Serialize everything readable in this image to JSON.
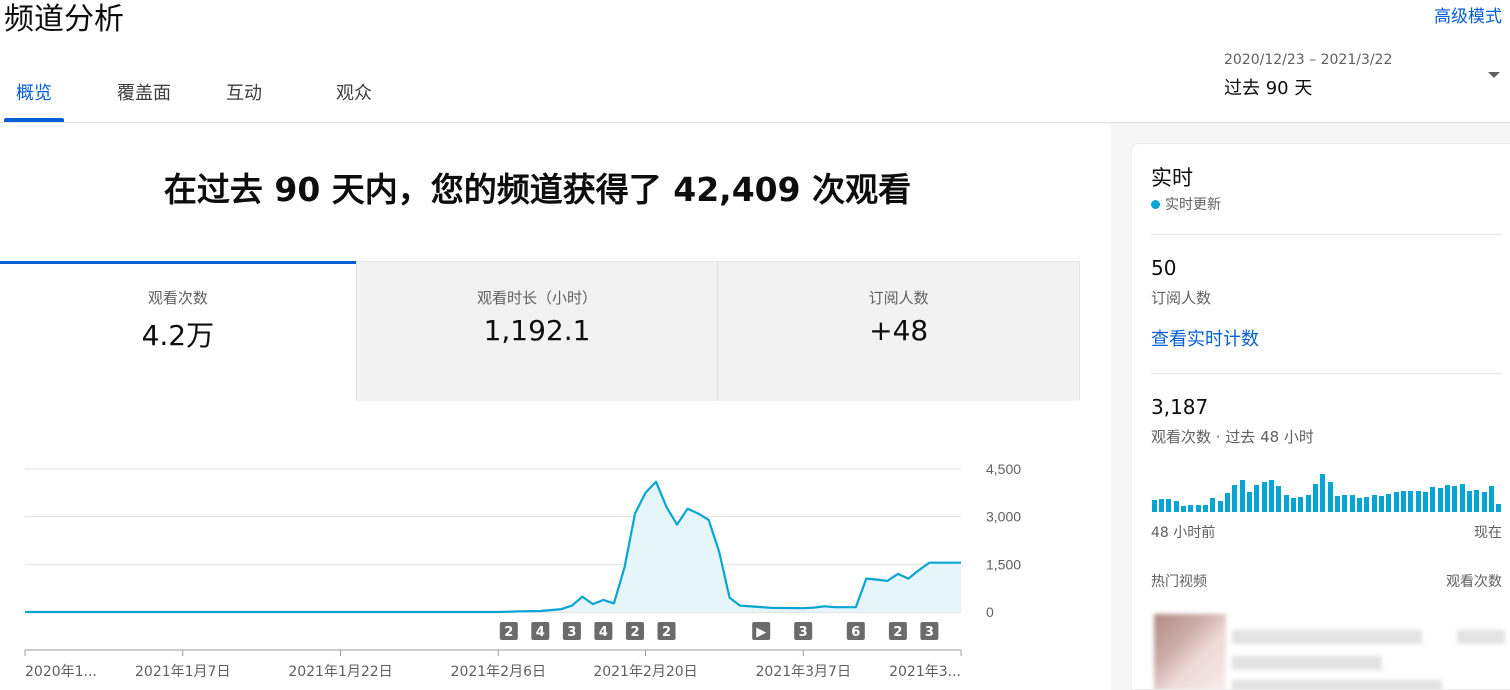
{
  "header": {
    "title": "频道分析",
    "advanced_mode": "高级模式"
  },
  "tabs": [
    {
      "label": "概览",
      "active": true
    },
    {
      "label": "覆盖面",
      "active": false
    },
    {
      "label": "互动",
      "active": false
    },
    {
      "label": "观众",
      "active": false
    }
  ],
  "date_picker": {
    "range": "2020/12/23 – 2021/3/22",
    "label": "过去 90 天"
  },
  "headline": "在过去 90 天内，您的频道获得了 42,409 次观看",
  "metrics": [
    {
      "label": "观看次数",
      "value": "4.2万",
      "active": true
    },
    {
      "label": "观看时长（小时）",
      "value": "1,192.1",
      "active": false
    },
    {
      "label": "订阅人数",
      "value": "+48",
      "active": false
    }
  ],
  "chart_data": {
    "type": "area",
    "ylim": [
      0,
      4500
    ],
    "y_ticks": [
      "4,500",
      "3,000",
      "1,500",
      "0"
    ],
    "x_tick_labels": [
      "2020年1...",
      "2021年1月7日",
      "2021年1月22日",
      "2021年2月6日",
      "2021年2月20日",
      "2021年3月7日",
      "2021年3..."
    ],
    "x_tick_dates": [
      "2020-12-23",
      "2021-01-07",
      "2021-01-22",
      "2021-02-06",
      "2021-02-20",
      "2021-03-07",
      "2021-03-22"
    ],
    "grid": true,
    "color": "#06a5d4",
    "series": [
      {
        "x": [
          "2020-12-23",
          "2021-02-06",
          "2021-02-08",
          "2021-02-10",
          "2021-02-12",
          "2021-02-13",
          "2021-02-14",
          "2021-02-15",
          "2021-02-16",
          "2021-02-17",
          "2021-02-18",
          "2021-02-19",
          "2021-02-20",
          "2021-02-21",
          "2021-02-22",
          "2021-02-23",
          "2021-02-24",
          "2021-02-25",
          "2021-02-26",
          "2021-02-27",
          "2021-02-28",
          "2021-03-01",
          "2021-03-04",
          "2021-03-07",
          "2021-03-08",
          "2021-03-09",
          "2021-03-10",
          "2021-03-11",
          "2021-03-12",
          "2021-03-13",
          "2021-03-14",
          "2021-03-15",
          "2021-03-16",
          "2021-03-17",
          "2021-03-18",
          "2021-03-19",
          "2021-03-20",
          "2021-03-21",
          "2021-03-22"
        ],
        "values": [
          0,
          0,
          20,
          30,
          90,
          200,
          480,
          250,
          380,
          270,
          1400,
          3100,
          3750,
          4100,
          3300,
          2750,
          3250,
          3100,
          2900,
          1900,
          450,
          200,
          130,
          120,
          140,
          180,
          150,
          150,
          150,
          1050,
          1020,
          980,
          1200,
          1050,
          1320,
          1550,
          1550,
          1550,
          1550
        ]
      }
    ],
    "markers": [
      {
        "label": "2",
        "date": "2021-02-07"
      },
      {
        "label": "4",
        "date": "2021-02-10"
      },
      {
        "label": "3",
        "date": "2021-02-13"
      },
      {
        "label": "4",
        "date": "2021-02-16"
      },
      {
        "label": "2",
        "date": "2021-02-19"
      },
      {
        "label": "2",
        "date": "2021-02-22"
      },
      {
        "label": "▶",
        "date": "2021-03-03"
      },
      {
        "label": "3",
        "date": "2021-03-07"
      },
      {
        "label": "6",
        "date": "2021-03-12"
      },
      {
        "label": "2",
        "date": "2021-03-16"
      },
      {
        "label": "3",
        "date": "2021-03-19"
      }
    ]
  },
  "realtime": {
    "title": "实时",
    "live_label": "实时更新",
    "subscribers_value": "50",
    "subscribers_label": "订阅人数",
    "view_live_link": "查看实时计数",
    "views_value": "3,187",
    "views_label": "观看次数 · 过去 48 小时",
    "axis_left": "48 小时前",
    "axis_right": "现在",
    "hourly_views": [
      12,
      13,
      13,
      11,
      6,
      7,
      7,
      7,
      14,
      11,
      19,
      27,
      32,
      20,
      27,
      30,
      32,
      26,
      17,
      14,
      15,
      17,
      28,
      38,
      30,
      16,
      17,
      17,
      14,
      15,
      17,
      16,
      18,
      20,
      21,
      21,
      21,
      20,
      25,
      24,
      27,
      26,
      28,
      21,
      22,
      20,
      26,
      8
    ],
    "hot_videos_label": "热门视频",
    "hot_videos_views_label": "观看次数"
  }
}
